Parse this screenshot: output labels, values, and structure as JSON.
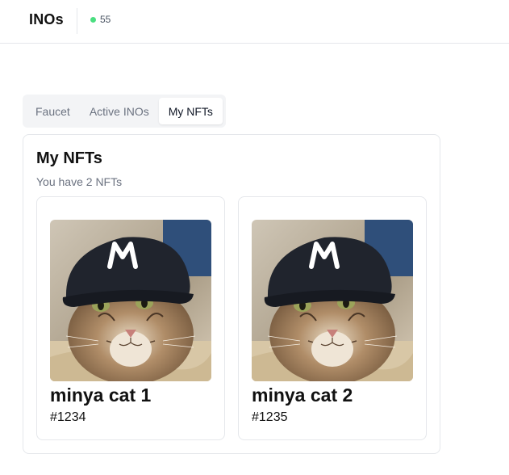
{
  "header": {
    "brand": "INOs",
    "status_count": "55",
    "status_color": "#4ade80"
  },
  "tabs": [
    {
      "label": "Faucet",
      "active": false
    },
    {
      "label": "Active INOs",
      "active": false
    },
    {
      "label": "My NFTs",
      "active": true
    }
  ],
  "panel": {
    "title": "My NFTs",
    "subtitle": "You have 2 NFTs"
  },
  "nfts": [
    {
      "name": "minya cat 1",
      "id": "#1234",
      "image": "cat-wearing-black-cap-with-M-logo"
    },
    {
      "name": "minya cat 2",
      "id": "#1235",
      "image": "cat-wearing-black-cap-with-M-logo"
    }
  ]
}
